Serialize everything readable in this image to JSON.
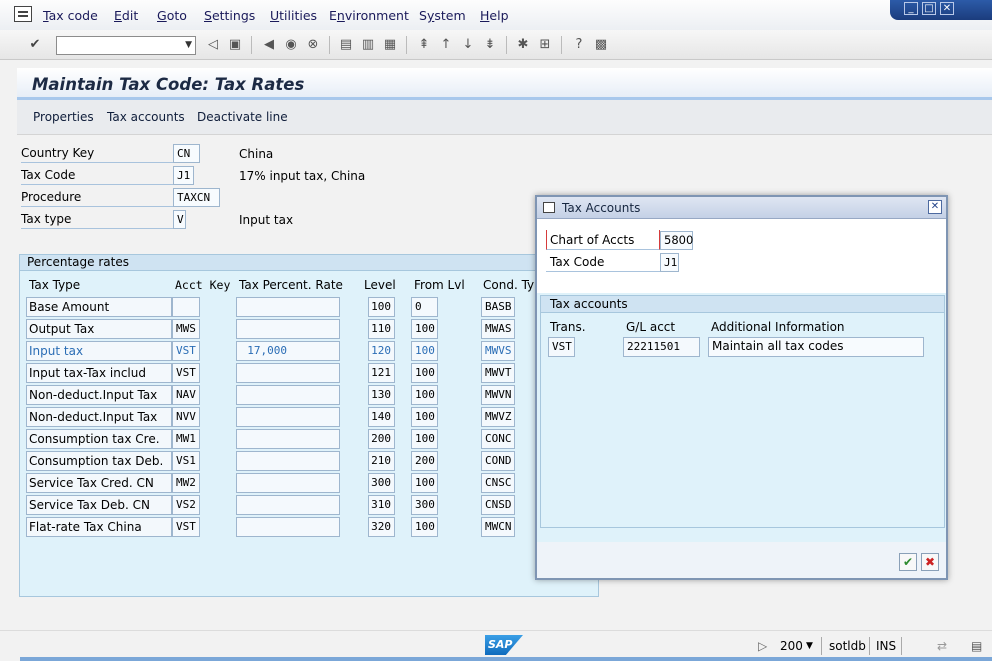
{
  "menu": {
    "items": [
      "Tax code",
      "Edit",
      "Goto",
      "Settings",
      "Utilities",
      "Environment",
      "System",
      "Help"
    ],
    "mnemonics": [
      "T",
      "E",
      "G",
      "S",
      "U",
      "n",
      "y",
      "H"
    ]
  },
  "title": "Maintain Tax Code: Tax Rates",
  "app_toolbar": [
    "Properties",
    "Tax accounts",
    "Deactivate line"
  ],
  "header_fields": {
    "country_key_label": "Country Key",
    "country_key_value": "CN",
    "country_name": "China",
    "tax_code_label": "Tax Code",
    "tax_code_value": "J1",
    "tax_code_desc": "17% input tax, China",
    "procedure_label": "Procedure",
    "procedure_value": "TAXCN",
    "tax_type_label": "Tax type",
    "tax_type_value": "V",
    "tax_type_desc": "Input tax"
  },
  "rates": {
    "group_title": "Percentage rates",
    "columns": [
      "Tax Type",
      "Acct Key",
      "Tax Percent. Rate",
      "Level",
      "From Lvl",
      "Cond. Typ"
    ],
    "rows": [
      {
        "tax_type": "Base Amount",
        "acct_key": "",
        "rate": "",
        "level": "100",
        "from": "0",
        "cond": "BASB",
        "selected": false
      },
      {
        "tax_type": "Output Tax",
        "acct_key": "MWS",
        "rate": "",
        "level": "110",
        "from": "100",
        "cond": "MWAS",
        "selected": false
      },
      {
        "tax_type": "Input tax",
        "acct_key": "VST",
        "rate": "17,000",
        "level": "120",
        "from": "100",
        "cond": "MWVS",
        "selected": true
      },
      {
        "tax_type": "Input tax-Tax includ",
        "acct_key": "VST",
        "rate": "",
        "level": "121",
        "from": "100",
        "cond": "MWVT",
        "selected": false
      },
      {
        "tax_type": "Non-deduct.Input Tax",
        "acct_key": "NAV",
        "rate": "",
        "level": "130",
        "from": "100",
        "cond": "MWVN",
        "selected": false
      },
      {
        "tax_type": "Non-deduct.Input Tax",
        "acct_key": "NVV",
        "rate": "",
        "level": "140",
        "from": "100",
        "cond": "MWVZ",
        "selected": false
      },
      {
        "tax_type": "Consumption tax Cre.",
        "acct_key": "MW1",
        "rate": "",
        "level": "200",
        "from": "100",
        "cond": "CONC",
        "selected": false
      },
      {
        "tax_type": "Consumption tax Deb.",
        "acct_key": "VS1",
        "rate": "",
        "level": "210",
        "from": "200",
        "cond": "COND",
        "selected": false
      },
      {
        "tax_type": "Service Tax Cred. CN",
        "acct_key": "MW2",
        "rate": "",
        "level": "300",
        "from": "100",
        "cond": "CNSC",
        "selected": false
      },
      {
        "tax_type": "Service Tax Deb. CN",
        "acct_key": "VS2",
        "rate": "",
        "level": "310",
        "from": "300",
        "cond": "CNSD",
        "selected": false
      },
      {
        "tax_type": "Flat-rate Tax China",
        "acct_key": "VST",
        "rate": "",
        "level": "320",
        "from": "100",
        "cond": "MWCN",
        "selected": false
      }
    ]
  },
  "popup": {
    "title": "Tax Accounts",
    "chart_label": "Chart of Accts",
    "chart_value": "5800",
    "tax_code_label": "Tax Code",
    "tax_code_value": "J1",
    "group_title": "Tax accounts",
    "col_trans": "Trans.",
    "col_gl": "G/L acct",
    "col_info": "Additional Information",
    "row": {
      "trans": "VST",
      "gl": "22211501",
      "info": "Maintain all tax codes"
    }
  },
  "status": {
    "client": "200",
    "server": "sotldb",
    "mode": "INS",
    "logo": "SAP"
  }
}
